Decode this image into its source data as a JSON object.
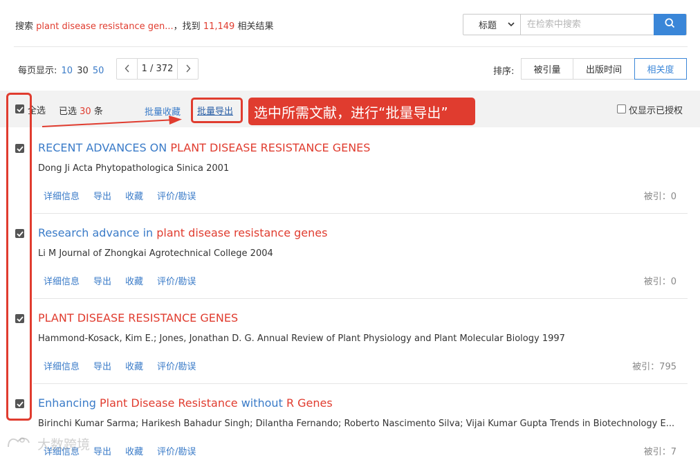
{
  "summary": {
    "prefix": "搜索",
    "query": "plant disease resistance gen...",
    "middle": "，找到",
    "count": "11,149",
    "suffix": "相关结果"
  },
  "search": {
    "field_value": "标题",
    "placeholder": "在检索中搜索",
    "button_icon": "search-icon"
  },
  "paging": {
    "per_page_label": "每页显示:",
    "options": [
      "10",
      "30",
      "50"
    ],
    "selected": "30",
    "page_text": "1 / 372"
  },
  "sort": {
    "label": "排序:",
    "options": [
      "被引量",
      "出版时间",
      "相关度"
    ],
    "active": "相关度"
  },
  "toolbar": {
    "select_all": "全选",
    "selected_prefix": "已选",
    "selected_count": "30",
    "selected_suffix": "条",
    "batch_fav": "批量收藏",
    "batch_export": "批量导出",
    "only_authorized": "仅显示已授权"
  },
  "annotation": {
    "callout_text": "选中所需文献，进行“批量导出”",
    "color": "#e03c2f"
  },
  "actions": [
    "详细信息",
    "导出",
    "收藏",
    "评价/勘误"
  ],
  "results": [
    {
      "title_parts": [
        {
          "text": "RECENT ADVANCES ON ",
          "hl": false
        },
        {
          "text": "PLANT DISEASE RESISTANCE GENES",
          "hl": true
        }
      ],
      "meta": "Dong Ji Acta Phytopathologica Sinica 2001",
      "cited": "被引：0"
    },
    {
      "title_parts": [
        {
          "text": "Research advance in ",
          "hl": false
        },
        {
          "text": "plant disease resistance genes",
          "hl": true
        }
      ],
      "meta": "Li M Journal of Zhongkai Agrotechnical College 2004",
      "cited": "被引：0"
    },
    {
      "title_parts": [
        {
          "text": "PLANT DISEASE RESISTANCE GENES",
          "hl": true
        }
      ],
      "meta": "Hammond-Kosack, Kim E.; Jones, Jonathan D. G. Annual Review of Plant Physiology and Plant Molecular Biology 1997",
      "cited": "被引：795"
    },
    {
      "title_parts": [
        {
          "text": "Enhancing ",
          "hl": false
        },
        {
          "text": "Plant Disease Resistance",
          "hl": true
        },
        {
          "text": " without ",
          "hl": false
        },
        {
          "text": "R",
          "hl": true
        },
        {
          "text": " ",
          "hl": false
        },
        {
          "text": "Genes",
          "hl": true
        }
      ],
      "meta": "Birinchi Kumar Sarma; Harikesh Bahadur Singh; Dilantha Fernando; Roberto Nascimento Silva; Vijai Kumar Gupta Trends in Biotechnology E...",
      "cited": "被引：7"
    }
  ],
  "watermark": {
    "text": "大数跨境"
  }
}
